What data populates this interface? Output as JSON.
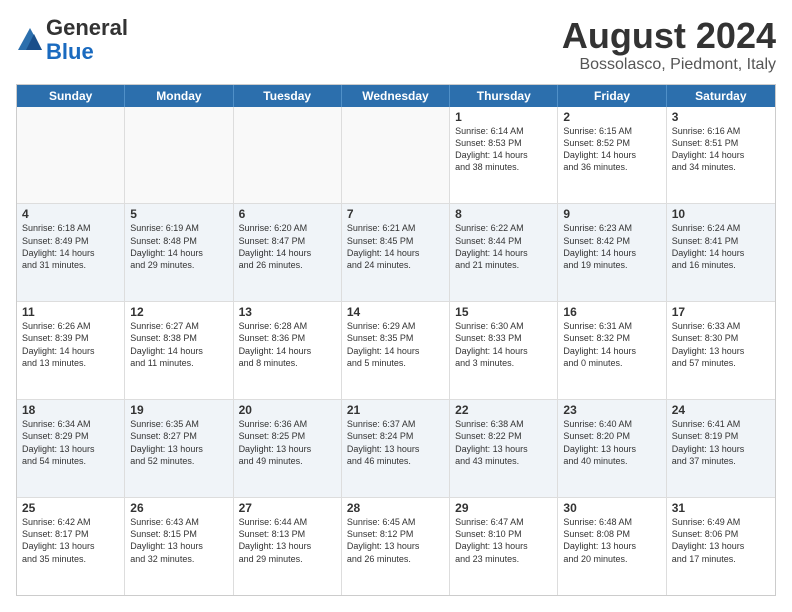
{
  "header": {
    "logo_general": "General",
    "logo_blue": "Blue",
    "month_title": "August 2024",
    "location": "Bossolasco, Piedmont, Italy"
  },
  "calendar": {
    "days_of_week": [
      "Sunday",
      "Monday",
      "Tuesday",
      "Wednesday",
      "Thursday",
      "Friday",
      "Saturday"
    ],
    "weeks": [
      [
        {
          "day": "",
          "info": ""
        },
        {
          "day": "",
          "info": ""
        },
        {
          "day": "",
          "info": ""
        },
        {
          "day": "",
          "info": ""
        },
        {
          "day": "1",
          "info": "Sunrise: 6:14 AM\nSunset: 8:53 PM\nDaylight: 14 hours\nand 38 minutes."
        },
        {
          "day": "2",
          "info": "Sunrise: 6:15 AM\nSunset: 8:52 PM\nDaylight: 14 hours\nand 36 minutes."
        },
        {
          "day": "3",
          "info": "Sunrise: 6:16 AM\nSunset: 8:51 PM\nDaylight: 14 hours\nand 34 minutes."
        }
      ],
      [
        {
          "day": "4",
          "info": "Sunrise: 6:18 AM\nSunset: 8:49 PM\nDaylight: 14 hours\nand 31 minutes."
        },
        {
          "day": "5",
          "info": "Sunrise: 6:19 AM\nSunset: 8:48 PM\nDaylight: 14 hours\nand 29 minutes."
        },
        {
          "day": "6",
          "info": "Sunrise: 6:20 AM\nSunset: 8:47 PM\nDaylight: 14 hours\nand 26 minutes."
        },
        {
          "day": "7",
          "info": "Sunrise: 6:21 AM\nSunset: 8:45 PM\nDaylight: 14 hours\nand 24 minutes."
        },
        {
          "day": "8",
          "info": "Sunrise: 6:22 AM\nSunset: 8:44 PM\nDaylight: 14 hours\nand 21 minutes."
        },
        {
          "day": "9",
          "info": "Sunrise: 6:23 AM\nSunset: 8:42 PM\nDaylight: 14 hours\nand 19 minutes."
        },
        {
          "day": "10",
          "info": "Sunrise: 6:24 AM\nSunset: 8:41 PM\nDaylight: 14 hours\nand 16 minutes."
        }
      ],
      [
        {
          "day": "11",
          "info": "Sunrise: 6:26 AM\nSunset: 8:39 PM\nDaylight: 14 hours\nand 13 minutes."
        },
        {
          "day": "12",
          "info": "Sunrise: 6:27 AM\nSunset: 8:38 PM\nDaylight: 14 hours\nand 11 minutes."
        },
        {
          "day": "13",
          "info": "Sunrise: 6:28 AM\nSunset: 8:36 PM\nDaylight: 14 hours\nand 8 minutes."
        },
        {
          "day": "14",
          "info": "Sunrise: 6:29 AM\nSunset: 8:35 PM\nDaylight: 14 hours\nand 5 minutes."
        },
        {
          "day": "15",
          "info": "Sunrise: 6:30 AM\nSunset: 8:33 PM\nDaylight: 14 hours\nand 3 minutes."
        },
        {
          "day": "16",
          "info": "Sunrise: 6:31 AM\nSunset: 8:32 PM\nDaylight: 14 hours\nand 0 minutes."
        },
        {
          "day": "17",
          "info": "Sunrise: 6:33 AM\nSunset: 8:30 PM\nDaylight: 13 hours\nand 57 minutes."
        }
      ],
      [
        {
          "day": "18",
          "info": "Sunrise: 6:34 AM\nSunset: 8:29 PM\nDaylight: 13 hours\nand 54 minutes."
        },
        {
          "day": "19",
          "info": "Sunrise: 6:35 AM\nSunset: 8:27 PM\nDaylight: 13 hours\nand 52 minutes."
        },
        {
          "day": "20",
          "info": "Sunrise: 6:36 AM\nSunset: 8:25 PM\nDaylight: 13 hours\nand 49 minutes."
        },
        {
          "day": "21",
          "info": "Sunrise: 6:37 AM\nSunset: 8:24 PM\nDaylight: 13 hours\nand 46 minutes."
        },
        {
          "day": "22",
          "info": "Sunrise: 6:38 AM\nSunset: 8:22 PM\nDaylight: 13 hours\nand 43 minutes."
        },
        {
          "day": "23",
          "info": "Sunrise: 6:40 AM\nSunset: 8:20 PM\nDaylight: 13 hours\nand 40 minutes."
        },
        {
          "day": "24",
          "info": "Sunrise: 6:41 AM\nSunset: 8:19 PM\nDaylight: 13 hours\nand 37 minutes."
        }
      ],
      [
        {
          "day": "25",
          "info": "Sunrise: 6:42 AM\nSunset: 8:17 PM\nDaylight: 13 hours\nand 35 minutes."
        },
        {
          "day": "26",
          "info": "Sunrise: 6:43 AM\nSunset: 8:15 PM\nDaylight: 13 hours\nand 32 minutes."
        },
        {
          "day": "27",
          "info": "Sunrise: 6:44 AM\nSunset: 8:13 PM\nDaylight: 13 hours\nand 29 minutes."
        },
        {
          "day": "28",
          "info": "Sunrise: 6:45 AM\nSunset: 8:12 PM\nDaylight: 13 hours\nand 26 minutes."
        },
        {
          "day": "29",
          "info": "Sunrise: 6:47 AM\nSunset: 8:10 PM\nDaylight: 13 hours\nand 23 minutes."
        },
        {
          "day": "30",
          "info": "Sunrise: 6:48 AM\nSunset: 8:08 PM\nDaylight: 13 hours\nand 20 minutes."
        },
        {
          "day": "31",
          "info": "Sunrise: 6:49 AM\nSunset: 8:06 PM\nDaylight: 13 hours\nand 17 minutes."
        }
      ]
    ]
  }
}
